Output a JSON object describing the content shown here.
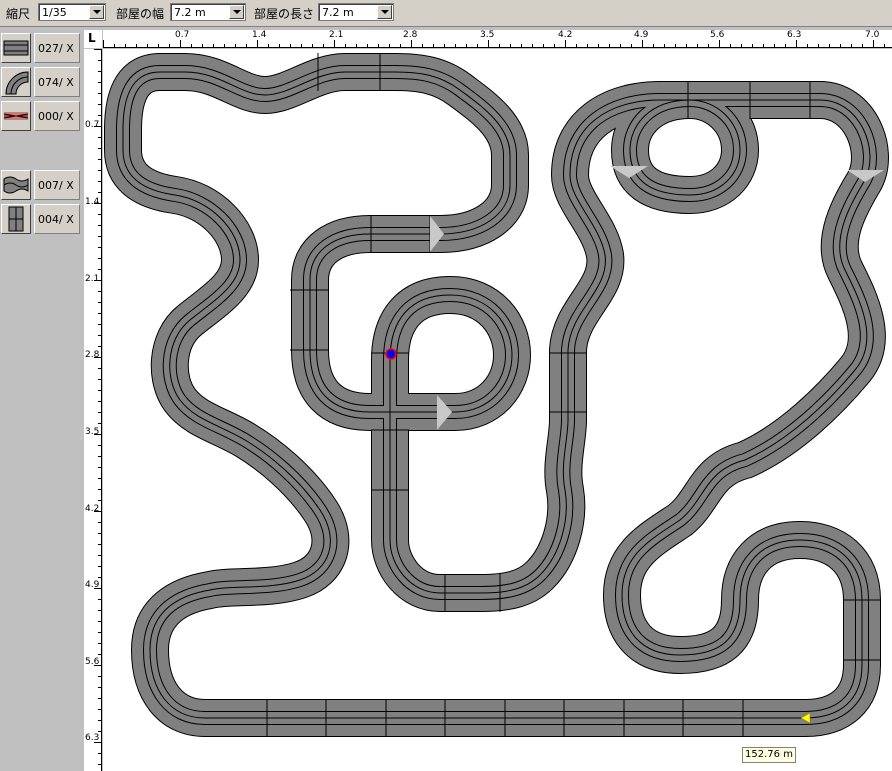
{
  "toolbar": {
    "scale_label": "縮尺",
    "scale_value": "1/35",
    "width_label": "部屋の幅",
    "width_value": "7.2 m",
    "length_label": "部屋の長さ",
    "length_value": "7.2 m"
  },
  "palette": {
    "items": [
      {
        "icon": "straight-track-icon",
        "count": "027/ X"
      },
      {
        "icon": "curve-track-icon",
        "count": "074/ X"
      },
      {
        "icon": "crossing-track-icon",
        "count": "000/ X"
      },
      {
        "icon": "wave-track-icon",
        "count": "007/ X"
      },
      {
        "icon": "lane-change-track-icon",
        "count": "004/ X"
      }
    ]
  },
  "ruler": {
    "corner_label": "L",
    "x_ticks": [
      "0.7",
      "1.4",
      "2.1",
      "2.8",
      "3.5",
      "4.2",
      "4.9",
      "5.6",
      "6.3",
      "7.0"
    ],
    "y_ticks": [
      "0.7",
      "1.4",
      "2.1",
      "2.8",
      "3.5",
      "4.2",
      "4.9",
      "5.6",
      "6.3"
    ]
  },
  "status": {
    "track_length": "152.76 m"
  },
  "colors": {
    "track_fill": "#808080",
    "track_line": "#000000",
    "canvas": "#ffffff",
    "start_marker": "#ffff00",
    "car_marker_outer": "#ff0000",
    "car_marker_inner": "#0000ff"
  }
}
